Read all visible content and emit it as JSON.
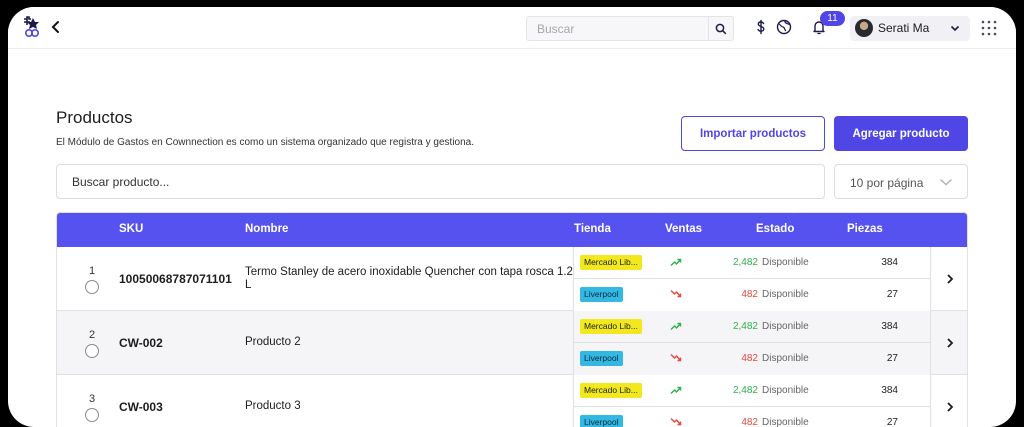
{
  "topbar": {
    "search_placeholder": "Buscar",
    "notification_count": "11",
    "user_name": "Serati Ma"
  },
  "page": {
    "title": "Productos",
    "subtitle": "El Módulo de Gastos en Cownnection es como un sistema organizado que registra y gestiona.",
    "import_button": "Importar productos",
    "add_button": "Agregar producto",
    "product_search_placeholder": "Buscar producto...",
    "per_page": "10 por página"
  },
  "table": {
    "headers": {
      "sku": "SKU",
      "name": "Nombre",
      "store": "Tienda",
      "sales": "Ventas",
      "status": "Estado",
      "pieces": "Piezas"
    },
    "rows": [
      {
        "num": "1",
        "sku": "10050068787071101",
        "name": "Termo Stanley de acero inoxidable Quencher con tapa rosca 1.2 L",
        "stores": [
          {
            "store": "Mercado Lib...",
            "trend": "up",
            "sales": "2,482",
            "status": "Disponible",
            "pieces": "384"
          },
          {
            "store": "Liverpool",
            "trend": "down",
            "sales": "482",
            "status": "Disponible",
            "pieces": "27"
          }
        ]
      },
      {
        "num": "2",
        "sku": "CW-002",
        "name": "Producto 2",
        "stores": [
          {
            "store": "Mercado Lib...",
            "trend": "up",
            "sales": "2,482",
            "status": "Disponible",
            "pieces": "384"
          },
          {
            "store": "Liverpool",
            "trend": "down",
            "sales": "482",
            "status": "Disponible",
            "pieces": "27"
          }
        ]
      },
      {
        "num": "3",
        "sku": "CW-003",
        "name": "Producto 3",
        "stores": [
          {
            "store": "Mercado Lib...",
            "trend": "up",
            "sales": "2,482",
            "status": "Disponible",
            "pieces": "384"
          },
          {
            "store": "Liverpool",
            "trend": "down",
            "sales": "482",
            "status": "Disponible",
            "pieces": "27"
          }
        ]
      }
    ]
  },
  "colors": {
    "accent": "#4f46e5",
    "header_bg": "#5552f0",
    "trend_up": "#2bb24c",
    "trend_down": "#e5483d",
    "tag_mercado": "#f2e81e",
    "tag_liverpool": "#33b8e4"
  },
  "icons": [
    "app-logo-icon",
    "back-arrow-icon",
    "search-icon",
    "dollar-icon",
    "globe-icon",
    "bell-icon",
    "chevron-down-icon",
    "apps-grid-icon",
    "trend-up-icon",
    "trend-down-icon",
    "chevron-right-icon"
  ]
}
